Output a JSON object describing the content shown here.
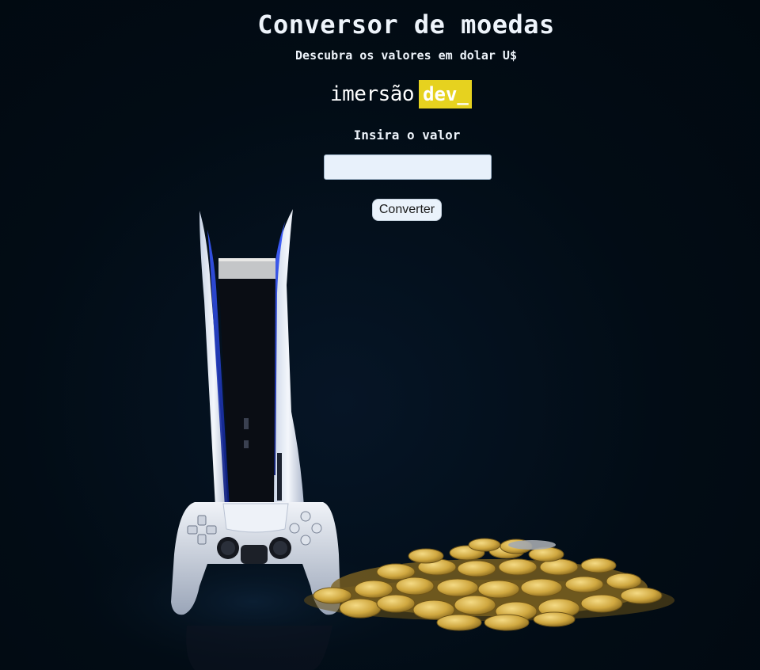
{
  "header": {
    "title": "Conversor de moedas",
    "subtitle": "Descubra os valores em dolar U$"
  },
  "logo": {
    "imersao": "imersão",
    "dev": "dev_"
  },
  "form": {
    "label": "Insira o valor",
    "input_value": "",
    "input_placeholder": "",
    "button_label": "Converter"
  },
  "colors": {
    "background": "#020c15",
    "logo_accent": "#e6d21f",
    "text": "#eef4fb",
    "console_accent": "#1e3cff",
    "coin_gold": "#c9a43a"
  },
  "illustration": {
    "icons": [
      "game-console-icon",
      "game-controller-icon",
      "coin-pile-icon"
    ]
  }
}
